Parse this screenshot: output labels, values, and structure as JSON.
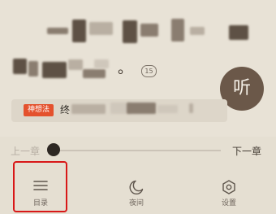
{
  "reader": {
    "visible_suffix": "。",
    "comment_count": "15",
    "listen_label": "听"
  },
  "idea": {
    "tag_label": "神想法",
    "text": "终"
  },
  "chapter": {
    "prev_label": "上一章",
    "next_label": "下一章"
  },
  "bottom_nav": {
    "items": [
      {
        "label": "目录",
        "icon": "menu-icon"
      },
      {
        "label": "夜间",
        "icon": "moon-icon"
      },
      {
        "label": "设置",
        "icon": "settings-icon"
      }
    ]
  },
  "colors": {
    "background": "#e6e0d3",
    "accent": "#e4512d",
    "listen_button": "#6b5849",
    "highlight": "#d81818"
  }
}
